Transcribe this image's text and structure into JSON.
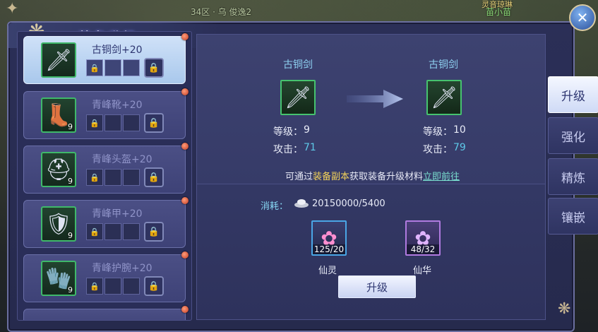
{
  "window": {
    "title": "装备升级"
  },
  "world": {
    "location": "34区 · 乌 俊逸2",
    "npc_top": "灵音琼琳",
    "npc_name": "苗小苗"
  },
  "equipment_list": [
    {
      "name": "古铜剑+20",
      "level": "",
      "selected": true
    },
    {
      "name": "青峰靴+20",
      "level": "9",
      "selected": false
    },
    {
      "name": "青峰头盔+20",
      "level": "9",
      "selected": false
    },
    {
      "name": "青峰甲+20",
      "level": "9",
      "selected": false
    },
    {
      "name": "青峰护腕+20",
      "level": "9",
      "selected": false
    }
  ],
  "upgrade": {
    "current": {
      "name": "古铜剑",
      "level_label": "等级：",
      "level": "9",
      "attack_label": "攻击：",
      "attack": "71"
    },
    "next": {
      "name": "古铜剑",
      "level_label": "等级：",
      "level": "10",
      "attack_label": "攻击：",
      "attack": "79"
    },
    "hint_prefix": "可通过",
    "hint_source": "装备副本",
    "hint_middle": "获取装备升级材料",
    "hint_link": "立即前往",
    "cost_label": "消耗：",
    "cost_value": "20150000/5400",
    "materials": [
      {
        "name": "仙灵",
        "count": "125/20",
        "color": "#4aa6e6"
      },
      {
        "name": "仙华",
        "count": "48/32",
        "color": "#b07ae0"
      }
    ],
    "button_label": "升级"
  },
  "tabs": [
    {
      "label": "升级",
      "active": true
    },
    {
      "label": "强化",
      "active": false
    },
    {
      "label": "精炼",
      "active": false
    },
    {
      "label": "镶嵌",
      "active": false
    }
  ],
  "colors": {
    "attack_current": "#5ec9e8",
    "attack_next": "#5ec9e8",
    "accent_gold": "#f2d25a"
  },
  "icons": {
    "sword": "sword-icon",
    "boots": "boots-icon",
    "helmet": "helmet-icon",
    "armor": "armor-icon",
    "bracer": "bracer-icon",
    "lock": "lock-icon",
    "close": "close-icon"
  }
}
